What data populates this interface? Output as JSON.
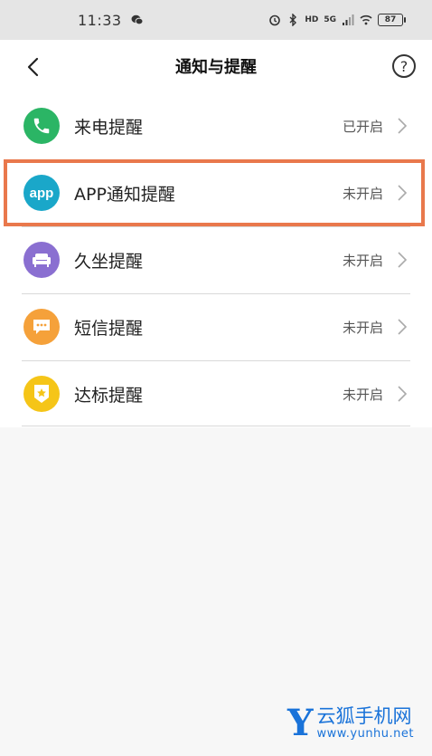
{
  "status_bar": {
    "time": "11:33",
    "network": "5G",
    "hd": "HD",
    "battery": "87"
  },
  "nav": {
    "title": "通知与提醒",
    "back_icon": "chevron-left-icon",
    "help_icon": "question-circle-icon",
    "help_symbol": "?"
  },
  "reminders": [
    {
      "label": "来电提醒",
      "status": "已开启",
      "icon": "phone-icon",
      "color": "#2bb565"
    },
    {
      "label": "APP通知提醒",
      "status": "未开启",
      "icon": "app-icon",
      "color": "#1aa7c9",
      "icon_text": "app"
    },
    {
      "label": "久坐提醒",
      "status": "未开启",
      "icon": "sofa-icon",
      "color": "#8a6fd1"
    },
    {
      "label": "短信提醒",
      "status": "未开启",
      "icon": "message-icon",
      "color": "#f5a13a"
    },
    {
      "label": "达标提醒",
      "status": "未开启",
      "icon": "badge-star-icon",
      "color": "#f5c518"
    }
  ],
  "highlight_color": "#e9784c",
  "watermark": {
    "logo": "Y",
    "name": "云狐手机网",
    "url": "www.yunhu.net"
  }
}
